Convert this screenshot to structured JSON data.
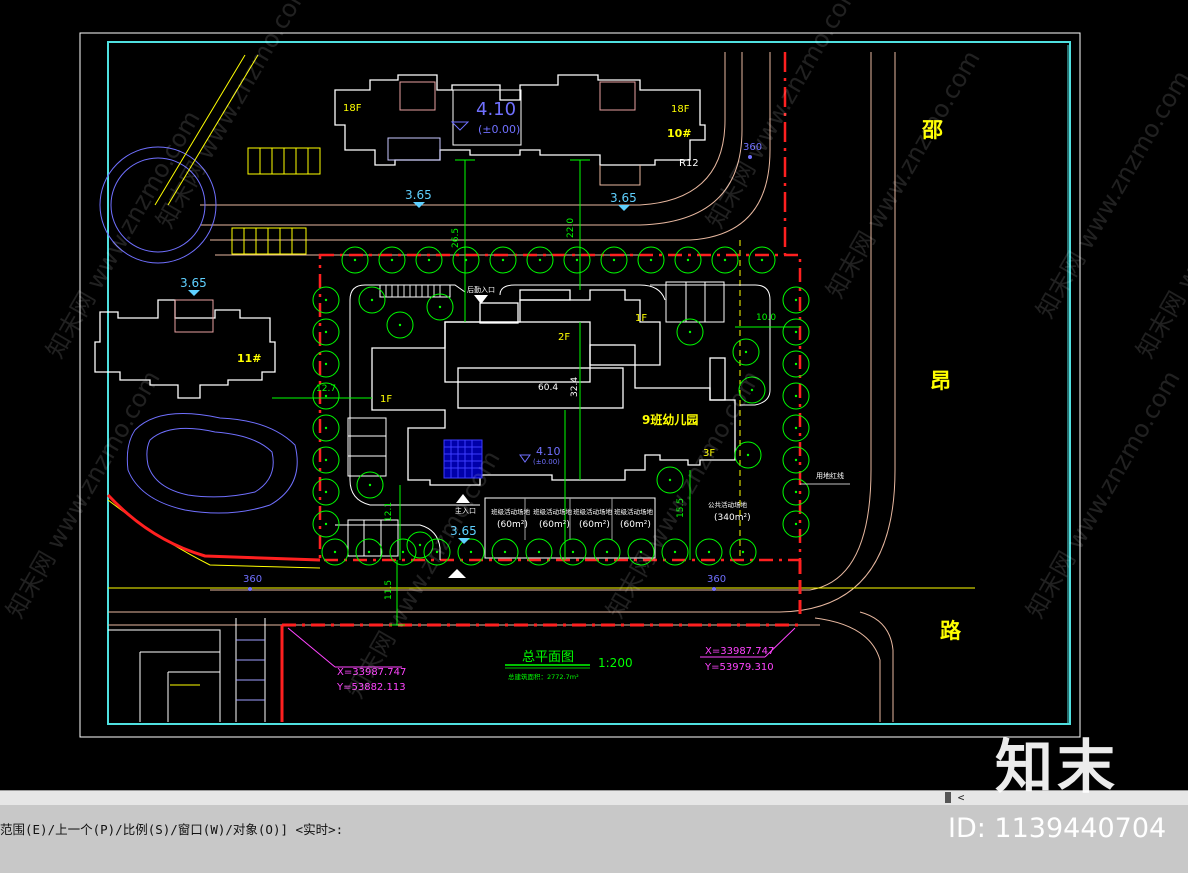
{
  "drawing": {
    "direction_labels": [
      "邵",
      "昂",
      "路"
    ],
    "plan_title": "总平面图",
    "plan_scale": "1:200",
    "total_area_note": "总建筑面积：2772.7m²",
    "coord_left": {
      "x": "X=33987.747",
      "y": "Y=53882.113"
    },
    "coord_right": {
      "x": "X=33987.747",
      "y": "Y=53979.310"
    },
    "kindergarten_name": "9班幼儿园",
    "building_10": {
      "floors_left": "18F",
      "floors_right": "18F",
      "label": "10#",
      "elevation": "4.10",
      "elevation_sub": "(±0.00)",
      "radius": "R12"
    },
    "building_11": {
      "label": "11#"
    },
    "kg_floor_labels": [
      "2F",
      "1F",
      "1F",
      "3F"
    ],
    "kg_elevation": "4.10",
    "kg_elevation_sub": "(±0.00)",
    "elevations_365": [
      "3.65",
      "3.65",
      "3.65",
      "3.65"
    ],
    "road_marks_360": [
      "360",
      "360",
      "360"
    ],
    "dimensions": [
      "26.5",
      "22.0",
      "10.0",
      "12.7",
      "60.4",
      "32.4",
      "12.1",
      "11.5",
      "15.5"
    ],
    "entrance_labels": {
      "main": "主入口",
      "secondary": "后勤入口"
    },
    "playground_labels": [
      {
        "name": "班级活动场地",
        "area": "(60m²)"
      },
      {
        "name": "班级活动场地",
        "area": "(60m²)"
      },
      {
        "name": "班级活动场地",
        "area": "(60m²)"
      },
      {
        "name": "班级活动场地",
        "area": "(60m²)"
      },
      {
        "name": "公共活动场地",
        "area": "(340m²)"
      }
    ],
    "boundary_label": "用地红线",
    "watermark_text": "知末网 www.znzmo.com"
  },
  "command_line": {
    "prompt": "范围(E)/上一个(P)/比例(S)/窗口(W)/对象(O)] <实时>:"
  },
  "watermark": {
    "logo": "知末",
    "id": "ID: 1139440704"
  },
  "colors": {
    "background": "#000000",
    "frame": "#4fe0e0",
    "boundary_red": "#ff2020",
    "building_white": "#ffffff",
    "road_yellow": "#ffff00",
    "tree_green": "#00ff00",
    "dimension_green": "#00ff00",
    "coord_magenta": "#ff44ff",
    "elevation_cyan": "#5fd0ff",
    "road_curve": "#e8b8a0",
    "rivulet": "#7070ff"
  }
}
